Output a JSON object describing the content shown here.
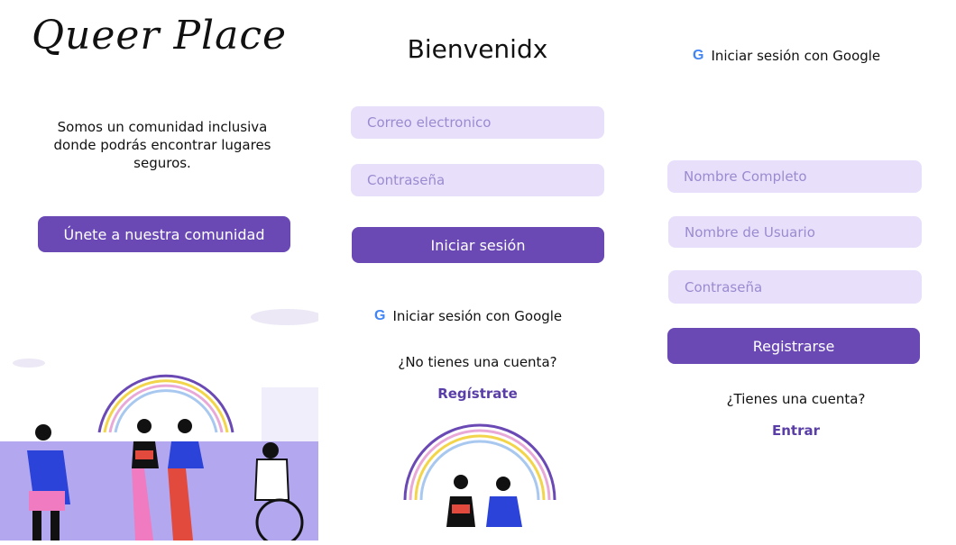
{
  "welcome": {
    "brand": "Queer Place",
    "intro": "Somos un comunidad inclusiva donde podrás encontrar lugares seguros.",
    "join_button": "Únete a nuestra comunidad"
  },
  "login": {
    "title": "Bienvenidx",
    "email_placeholder": "Correo electronico",
    "password_placeholder": "Contraseña",
    "login_button": "Iniciar sesión",
    "google_login": "Iniciar sesión con Google",
    "no_account": "¿No tienes una cuenta?",
    "register_link": "Regístrate"
  },
  "register": {
    "google_login": "Iniciar sesión con Google",
    "fullname_placeholder": "Nombre Completo",
    "username_placeholder": "Nombre de Usuario",
    "password_placeholder": "Contraseña",
    "register_button": "Registrarse",
    "have_account": "¿Tienes una cuenta?",
    "enter_link": "Entrar"
  },
  "colors": {
    "primary": "#6a49b5",
    "field_bg": "#e8e0fb",
    "link": "#5a3ea8"
  },
  "icons": [
    "google-icon"
  ]
}
